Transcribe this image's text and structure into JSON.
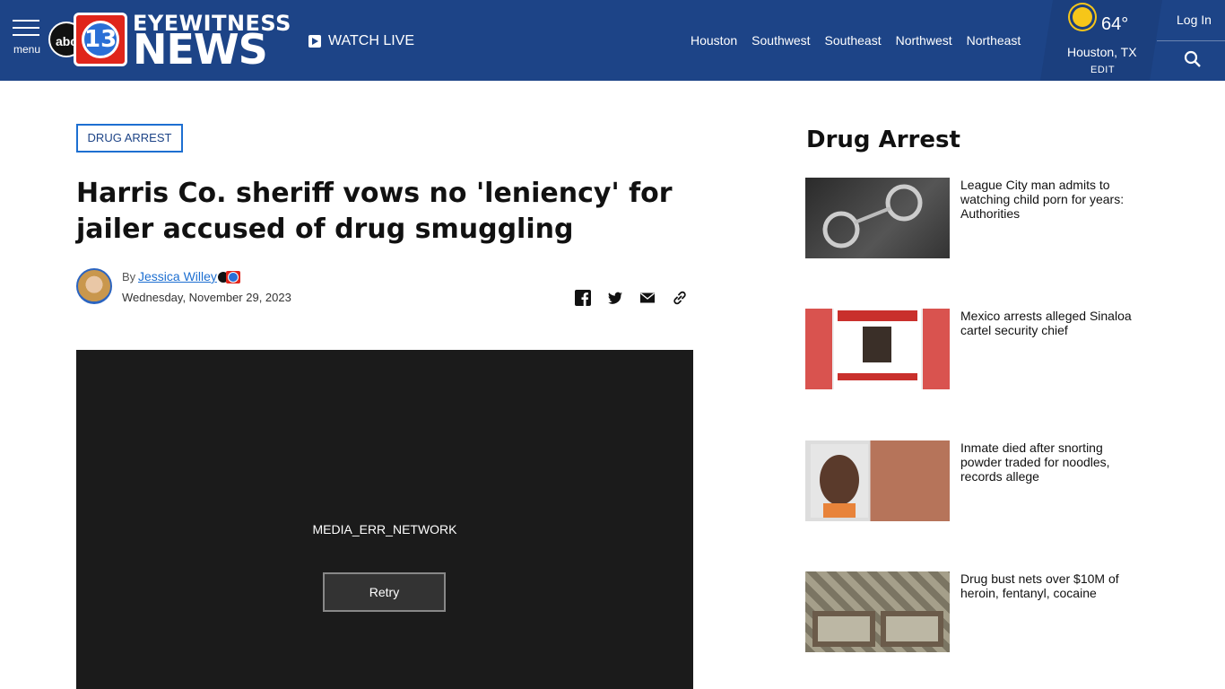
{
  "header": {
    "menu_label": "menu",
    "logo_abc": "abc",
    "logo_number": "13",
    "logo_eyewitness": "EYEWITNESS",
    "logo_news": "NEWS",
    "watch_live": "WATCH LIVE",
    "regions": [
      "Houston",
      "Southwest",
      "Southeast",
      "Northwest",
      "Northeast"
    ],
    "weather": {
      "temp": "64°",
      "city": "Houston, TX",
      "edit": "EDIT",
      "icon": "sun-icon"
    },
    "login": "Log In"
  },
  "article": {
    "tag": "DRUG ARREST",
    "headline": "Harris Co. sheriff vows no 'leniency' for jailer accused of drug smuggling",
    "by_label": "By",
    "author": "Jessica Willey",
    "date": "Wednesday, November 29, 2023",
    "share_icons": [
      "facebook-icon",
      "twitter-icon",
      "email-icon",
      "link-icon"
    ]
  },
  "player": {
    "error": "MEDIA_ERR_NETWORK",
    "retry": "Retry"
  },
  "sidebar": {
    "title": "Drug Arrest",
    "stories": [
      {
        "text": "League City man admits to watching child porn for years: Authorities"
      },
      {
        "text": "Mexico arrests alleged Sinaloa cartel security chief"
      },
      {
        "text": "Inmate died after snorting powder traded for noodles, records allege"
      },
      {
        "text": "Drug bust nets over $10M of heroin, fentanyl, cocaine"
      }
    ]
  },
  "colors": {
    "header": "#1d4487",
    "accent": "#1d6fd1",
    "player": "#1b1b1b"
  }
}
